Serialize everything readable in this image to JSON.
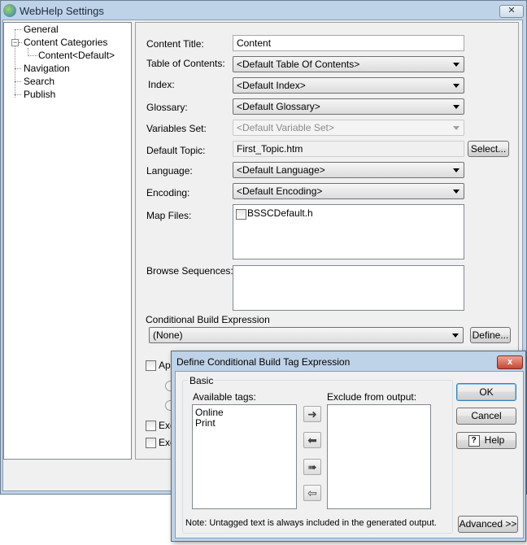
{
  "window": {
    "title": "WebHelp Settings",
    "close": "✕"
  },
  "tree": {
    "items": [
      {
        "label": "General"
      },
      {
        "label": "Content Categories"
      },
      {
        "label": "Content<Default>"
      },
      {
        "label": "Navigation"
      },
      {
        "label": "Search"
      },
      {
        "label": "Publish"
      }
    ],
    "expander": "−"
  },
  "form": {
    "content_title_label": "Content Title:",
    "content_title_value": "Content",
    "toc_label": "Table of Contents:",
    "toc_value": "<Default Table Of Contents>",
    "index_label": "Index:",
    "index_value": "<Default Index>",
    "glossary_label": "Glossary:",
    "glossary_value": "<Default Glossary>",
    "variables_label": "Variables Set:",
    "variables_value": "<Default Variable Set>",
    "default_topic_label": "Default Topic:",
    "default_topic_value": "First_Topic.htm",
    "select_button": "Select...",
    "language_label": "Language:",
    "language_value": "<Default Language>",
    "encoding_label": "Encoding:",
    "encoding_value": "<Default Encoding>",
    "map_files_label": "Map Files:",
    "map_files_items": [
      "BSSCDefault.h"
    ],
    "browse_label": "Browse Sequences:",
    "cbe_label": "Conditional Build Expression",
    "cbe_value": "(None)",
    "define_button": "Define...",
    "apply_partial": "App",
    "exclude_partial_1": "Exc",
    "exclude_partial_2": "Exc"
  },
  "dialog": {
    "title": "Define Conditional Build Tag Expression",
    "close": "x",
    "group_label": "Basic",
    "available_label": "Available tags:",
    "available_items": [
      "Online",
      "Print"
    ],
    "exclude_label": "Exclude from output:",
    "note": "Note: Untagged text is always included in the generated output.",
    "ok": "OK",
    "cancel": "Cancel",
    "help": "Help",
    "help_icon": "?",
    "advanced": "Advanced >>",
    "arrow_right": "➜",
    "arrow_left": "⬅",
    "arrow_all_right": "➠",
    "arrow_all_left": "⇦"
  }
}
